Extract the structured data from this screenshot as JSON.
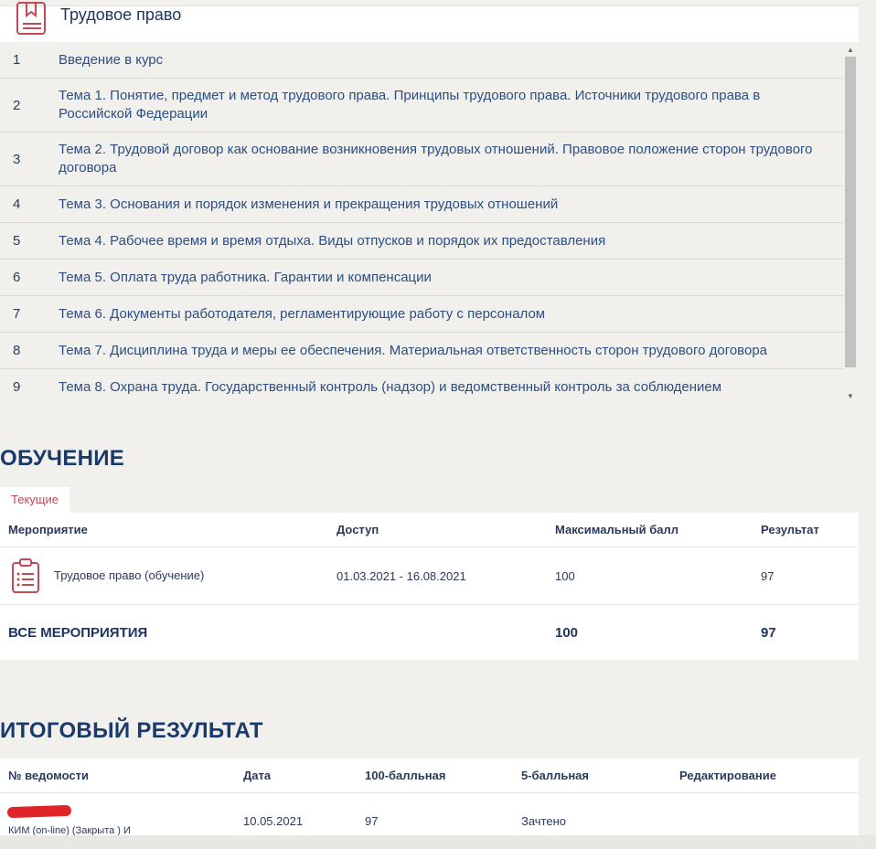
{
  "course": {
    "title": "Трудовое право",
    "icon": "book-icon"
  },
  "topics": [
    {
      "num": "1",
      "text": "Введение в курс"
    },
    {
      "num": "2",
      "text": "Тема 1. Понятие, предмет и метод трудового права. Принципы трудового права. Источники трудового права в Российской Федерации"
    },
    {
      "num": "3",
      "text": "Тема 2. Трудовой договор как основание возникновения трудовых отношений. Правовое положение сторон трудового договора"
    },
    {
      "num": "4",
      "text": "Тема 3. Основания и порядок изменения и прекращения трудовых отношений"
    },
    {
      "num": "5",
      "text": "Тема 4. Рабочее время и время отдыха. Виды отпусков и порядок их предоставления"
    },
    {
      "num": "6",
      "text": "Тема 5. Оплата труда работника. Гарантии и компенсации"
    },
    {
      "num": "7",
      "text": "Тема 6. Документы работодателя, регламентирующие работу с персоналом"
    },
    {
      "num": "8",
      "text": "Тема 7. Дисциплина труда и меры ее обеспечения. Материальная ответственность сторон трудового договора"
    },
    {
      "num": "9",
      "text": "Тема 8. Охрана труда. Государственный контроль (надзор) и ведомственный контроль за соблюдением"
    }
  ],
  "training": {
    "title": "ОБУЧЕНИЕ",
    "tab": "Текущие",
    "headers": {
      "event": "Мероприятие",
      "access": "Доступ",
      "max": "Максимальный балл",
      "result": "Результат"
    },
    "row": {
      "icon": "clipboard-icon",
      "event": "Трудовое право (обучение)",
      "access": "01.03.2021 - 16.08.2021",
      "max": "100",
      "result": "97"
    },
    "total": {
      "label": "ВСЕ МЕРОПРИЯТИЯ",
      "max": "100",
      "result": "97"
    }
  },
  "final": {
    "title": "ИТОГОВЫЙ РЕЗУЛЬТАТ",
    "headers": {
      "sheet": "№ ведомости",
      "date": "Дата",
      "score100": "100-балльная",
      "score5": "5-балльная",
      "edit": "Редактирование"
    },
    "row": {
      "sheet": "КИМ (on-line) (Закрыта ) И",
      "date": "10.05.2021",
      "score100": "97",
      "score5": "Зачтено"
    }
  },
  "colors": {
    "accent": "#c14a54",
    "title": "#1a3a6c",
    "link": "#2b4f82",
    "redaction": "#e0252a"
  }
}
